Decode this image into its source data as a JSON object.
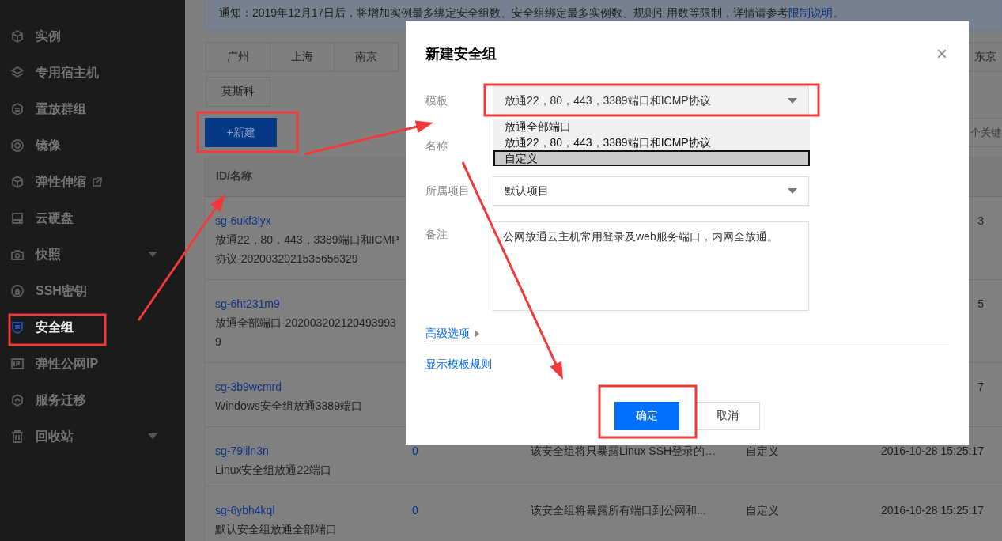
{
  "sidebar": {
    "items": [
      {
        "label": "实例",
        "selected": false,
        "submenu": false,
        "external": false
      },
      {
        "label": "专用宿主机",
        "selected": false,
        "submenu": false,
        "external": false
      },
      {
        "label": "置放群组",
        "selected": false,
        "submenu": false,
        "external": false
      },
      {
        "label": "镜像",
        "selected": false,
        "submenu": false,
        "external": false
      },
      {
        "label": "弹性伸缩",
        "selected": false,
        "submenu": false,
        "external": true
      },
      {
        "label": "云硬盘",
        "selected": false,
        "submenu": false,
        "external": false
      },
      {
        "label": "快照",
        "selected": false,
        "submenu": true,
        "external": false
      },
      {
        "label": "SSH密钥",
        "selected": false,
        "submenu": false,
        "external": false
      },
      {
        "label": "安全组",
        "selected": true,
        "submenu": false,
        "external": false
      },
      {
        "label": "弹性公网IP",
        "selected": false,
        "submenu": false,
        "external": false
      },
      {
        "label": "服务迁移",
        "selected": false,
        "submenu": false,
        "external": false
      },
      {
        "label": "回收站",
        "selected": false,
        "submenu": true,
        "external": false
      }
    ]
  },
  "notice": {
    "text": "通知：2019年12月17日后，将增加实例最多绑定安全组数、安全组绑定最多实例数、规则引用数等限制，详情请参考",
    "link": "限制说明",
    "end": "。"
  },
  "region_tabs": [
    [
      "广州",
      "上海",
      "南京",
      "东京"
    ],
    [
      "莫斯科"
    ]
  ],
  "new_button": "+新建",
  "search": {
    "placeholder": "个关键"
  },
  "table": {
    "columns": [
      "ID/名称"
    ],
    "rows": [
      {
        "id": "sg-6ukf3lyx",
        "name": "放通22，80，443，3389端口和ICMP协议-2020032021535656329",
        "count": "",
        "note": "",
        "type": "",
        "date": "3"
      },
      {
        "id": "sg-6ht231m9",
        "name": "放通全部端口-2020032021204939939",
        "count": "",
        "note": "",
        "type": "",
        "date": "5"
      },
      {
        "id": "sg-3b9wcmrd",
        "name": "Windows安全组放通3389端口",
        "count": "",
        "note": "",
        "type": "",
        "date": "7"
      },
      {
        "id": "sg-79liln3n",
        "name": "Linux安全组放通22端口",
        "count": "0",
        "note": "该安全组将只暴露Linux SSH登录的…",
        "type": "自定义",
        "date": "2016-10-28 15:25:17"
      },
      {
        "id": "sg-6ybh4kql",
        "name": "默认安全组放通全部端口",
        "count": "0",
        "note": "该安全组将暴露所有端口到公网和...",
        "type": "自定义",
        "date": "2016-10-28 15:25:17"
      }
    ]
  },
  "dialog": {
    "title": "新建安全组",
    "close": "×",
    "template": {
      "label": "模板",
      "value": "放通22，80，443，3389端口和ICMP协议",
      "options": [
        {
          "label": "放通全部端口",
          "highlighted": false
        },
        {
          "label": "放通22，80，443，3389端口和ICMP协议",
          "highlighted": false
        },
        {
          "label": "自定义",
          "highlighted": true
        }
      ]
    },
    "name": {
      "label": "名称"
    },
    "project": {
      "label": "所属项目",
      "value": "默认项目"
    },
    "remark": {
      "label": "备注",
      "value": "公网放通云主机常用登录及web服务端口，内网全放通。"
    },
    "advanced": "高级选项",
    "show_rules": "显示模板规则",
    "buttons": [
      {
        "label": "确定",
        "kind": "primary"
      },
      {
        "label": "取消",
        "kind": "default"
      }
    ]
  }
}
